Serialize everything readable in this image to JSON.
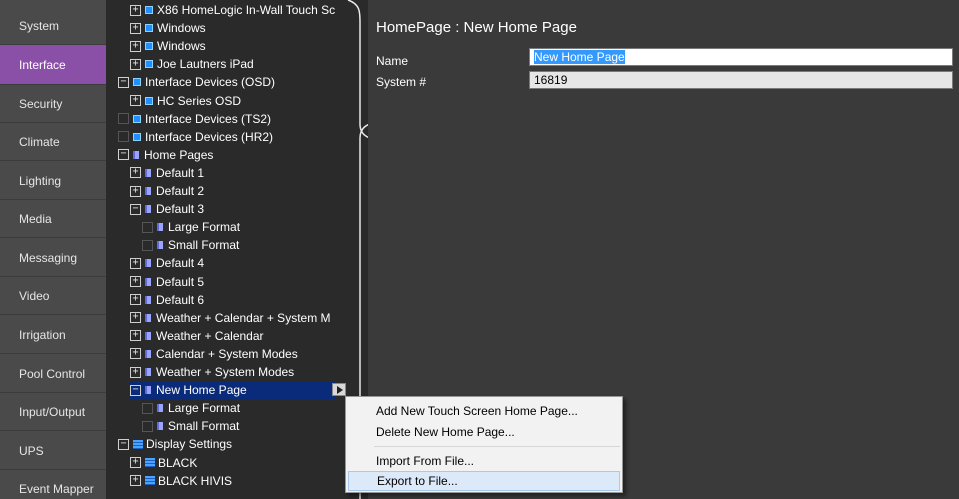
{
  "nav": {
    "items": [
      {
        "label": "System",
        "active": false
      },
      {
        "label": "Interface",
        "active": true
      },
      {
        "label": "Security",
        "active": false
      },
      {
        "label": "Climate",
        "active": false
      },
      {
        "label": "Lighting",
        "active": false
      },
      {
        "label": "Media",
        "active": false
      },
      {
        "label": "Messaging",
        "active": false
      },
      {
        "label": "Video",
        "active": false
      },
      {
        "label": "Irrigation",
        "active": false
      },
      {
        "label": "Pool Control",
        "active": false
      },
      {
        "label": "Input/Output",
        "active": false
      },
      {
        "label": "UPS",
        "active": false
      },
      {
        "label": "Event Mapper",
        "active": false
      }
    ]
  },
  "tree": {
    "rows": [
      {
        "label": "X86 HomeLogic In-Wall Touch Sc",
        "icon": "device-icon",
        "expander": "+"
      },
      {
        "label": "Windows",
        "icon": "device-icon",
        "expander": "+"
      },
      {
        "label": "Windows",
        "icon": "device-icon",
        "expander": "+"
      },
      {
        "label": "Joe Lautners iPad",
        "icon": "device-icon",
        "expander": "+"
      },
      {
        "label": "Interface Devices (OSD)",
        "icon": "device-icon",
        "expander": "−"
      },
      {
        "label": "HC Series OSD",
        "icon": "device-icon",
        "expander": "+"
      },
      {
        "label": "Interface Devices (TS2)",
        "icon": "device-icon",
        "expander": ""
      },
      {
        "label": "Interface Devices (HR2)",
        "icon": "device-icon",
        "expander": ""
      },
      {
        "label": "Home Pages",
        "icon": "page-icon",
        "expander": "−"
      },
      {
        "label": "Default 1",
        "icon": "page-icon",
        "expander": "+"
      },
      {
        "label": "Default 2",
        "icon": "page-icon",
        "expander": "+"
      },
      {
        "label": "Default 3",
        "icon": "page-icon",
        "expander": "−"
      },
      {
        "label": "Large Format",
        "icon": "page-icon",
        "expander": ""
      },
      {
        "label": "Small Format",
        "icon": "page-icon",
        "expander": ""
      },
      {
        "label": "Default 4",
        "icon": "page-icon",
        "expander": "+"
      },
      {
        "label": "Default 5",
        "icon": "page-icon",
        "expander": "+"
      },
      {
        "label": "Default 6",
        "icon": "page-icon",
        "expander": "+"
      },
      {
        "label": "Weather + Calendar + System M",
        "icon": "page-icon",
        "expander": "+"
      },
      {
        "label": "Weather + Calendar",
        "icon": "page-icon",
        "expander": "+"
      },
      {
        "label": "Calendar + System Modes",
        "icon": "page-icon",
        "expander": "+"
      },
      {
        "label": "Weather + System Modes",
        "icon": "page-icon",
        "expander": "+"
      },
      {
        "label": "New Home Page",
        "icon": "page-icon",
        "expander": "−",
        "selected": true
      },
      {
        "label": "Large Format",
        "icon": "page-icon",
        "expander": ""
      },
      {
        "label": "Small Format",
        "icon": "page-icon",
        "expander": ""
      },
      {
        "label": "Display Settings",
        "icon": "display-icon",
        "expander": "−"
      },
      {
        "label": "BLACK",
        "icon": "display-icon",
        "expander": "+"
      },
      {
        "label": "BLACK HIVIS",
        "icon": "display-icon",
        "expander": "+"
      }
    ]
  },
  "panel": {
    "title": "HomePage : New Home Page",
    "name_label": "Name",
    "name_value": "New Home Page",
    "system_label": "System #",
    "system_value": "16819"
  },
  "context_menu": {
    "items": [
      "Add New Touch Screen Home Page...",
      "Delete New Home Page...",
      "Import From File...",
      "Export to File..."
    ]
  },
  "colors": {
    "nav_active": "#8a4fa6",
    "selection": "#0a2a7a",
    "menu_hover": "#dbe9f9"
  }
}
